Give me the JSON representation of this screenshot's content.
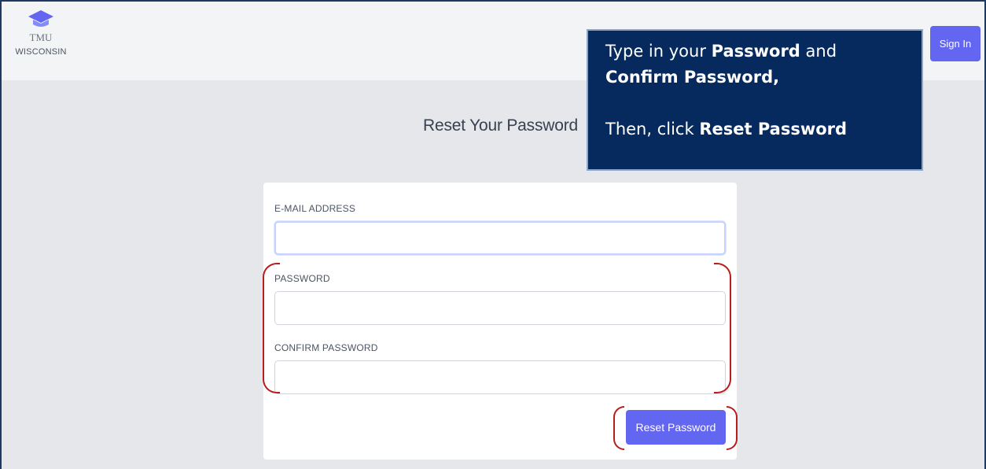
{
  "header": {
    "logo_top": "TMU",
    "logo_bottom": "WISCONSIN",
    "sign_in_label": "Sign In"
  },
  "callout": {
    "line1_pre": "Type in your ",
    "line1_bold": "Password",
    "line1_post": " and",
    "line2_bold": "Confirm Password",
    "line2_post": ",",
    "line3_pre": "Then, click ",
    "line3_bold": "Reset Password",
    "background": "#062a5e"
  },
  "main": {
    "title": "Reset Your Password",
    "form": {
      "email_label": "E-MAIL ADDRESS",
      "email_value": "",
      "password_label": "PASSWORD",
      "password_value": "",
      "confirm_label": "CONFIRM PASSWORD",
      "confirm_value": "",
      "submit_label": "Reset Password"
    }
  },
  "colors": {
    "accent": "#6366f1",
    "highlight": "#b91c1c",
    "page_bg": "#e5e7eb"
  }
}
